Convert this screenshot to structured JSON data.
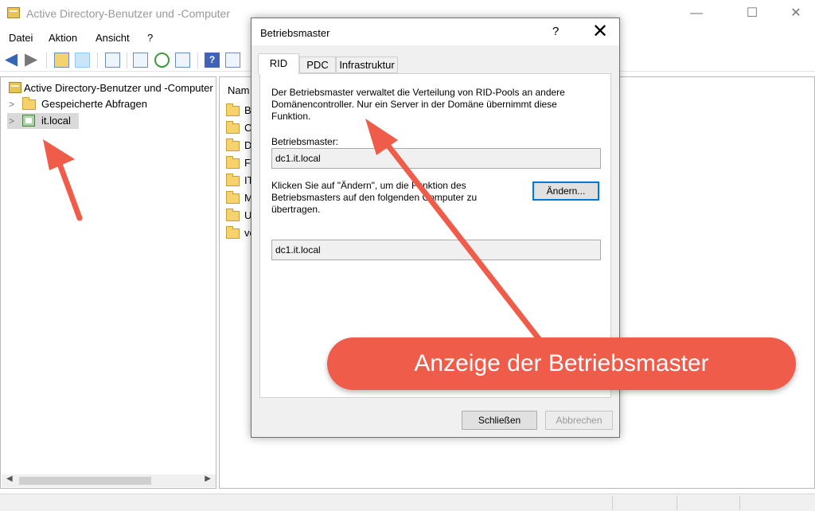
{
  "window": {
    "title": "Active Directory-Benutzer und -Computer",
    "controls": [
      "—",
      "☐",
      "✕"
    ]
  },
  "menu": [
    "Datei",
    "Aktion",
    "Ansicht",
    "?"
  ],
  "toolbar": {
    "icons": [
      "back-arrow-icon",
      "forward-arrow-icon",
      "up-folder-icon",
      "console-tree-icon",
      "clipboard-icon",
      "properties-icon",
      "refresh-icon",
      "export-icon",
      "help-icon",
      "view-icon"
    ]
  },
  "tree": {
    "root": "Active Directory-Benutzer und -Computer",
    "items": [
      {
        "label": "Gespeicherte Abfragen",
        "expander": ">"
      },
      {
        "label": "it.local",
        "expander": ">"
      }
    ]
  },
  "list": {
    "column": "Nam",
    "items": [
      "Bu",
      "Co",
      "Do",
      "Fo",
      "IT",
      "M",
      "Us",
      "ve"
    ]
  },
  "dialog": {
    "title": "Betriebsmaster",
    "help": "?",
    "close": "✕",
    "tabs": [
      "RID",
      "PDC",
      "Infrastruktur"
    ],
    "active_tab": "RID",
    "description": "Der Betriebsmaster verwaltet die Verteilung von RID-Pools an andere Domänencontroller. Nur ein Server in der Domäne übernimmt diese Funktion.",
    "operations_master_label": "Betriebsmaster:",
    "operations_master_value": "dc1.it.local",
    "change_hint": "Klicken Sie auf \"Ändern\", um die Funktion des Betriebsmasters auf den folgenden Computer zu übertragen.",
    "change_button": "Ändern...",
    "target_value": "dc1.it.local",
    "close_button": "Schließen",
    "cancel_button": "Abbrechen"
  },
  "annotation": {
    "callout": "Anzeige der Betriebsmaster",
    "color": "#ef5c4a"
  }
}
